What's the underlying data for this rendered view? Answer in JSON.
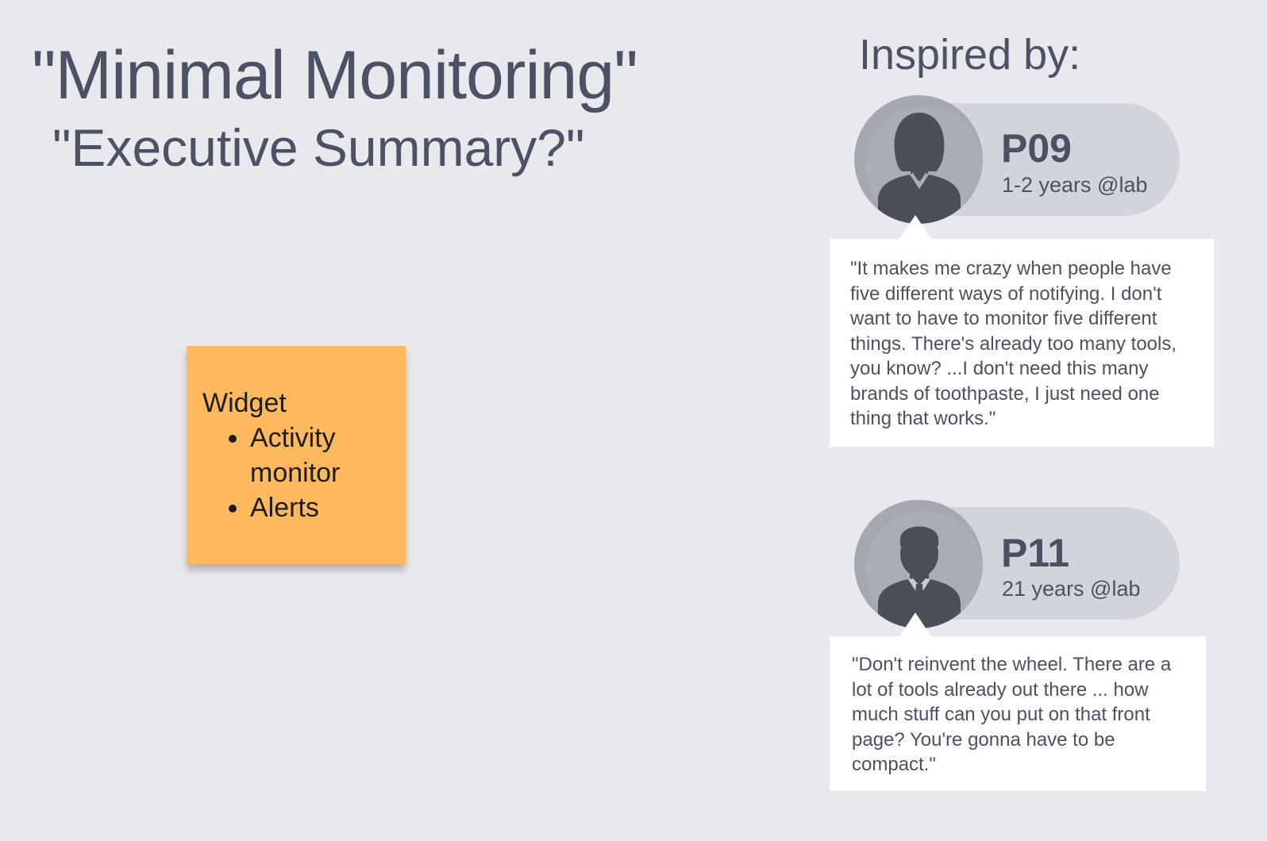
{
  "title": "\"Minimal Monitoring\"",
  "subtitle": "\"Executive Summary?\"",
  "inspired_label": "Inspired by:",
  "sticky": {
    "heading": "Widget",
    "items": [
      "Activity monitor",
      "Alerts"
    ],
    "color": "#feb95c"
  },
  "participants": [
    {
      "id": "P09",
      "tenure": "1-2 years @lab",
      "avatar_icon": "female-user-icon",
      "quote": "\"It makes me crazy when people have five different ways of notifying. I don't want to have to monitor five different things. There's already too many tools, you know? ...I don't need this many brands of toothpaste, I just need one thing that works.\""
    },
    {
      "id": "P11",
      "tenure": "21 years @lab",
      "avatar_icon": "male-user-icon",
      "quote": "\"Don't reinvent the wheel. There are a lot of tools already out there ... how much stuff can you put on that front page? You're gonna have to be compact.\""
    }
  ]
}
